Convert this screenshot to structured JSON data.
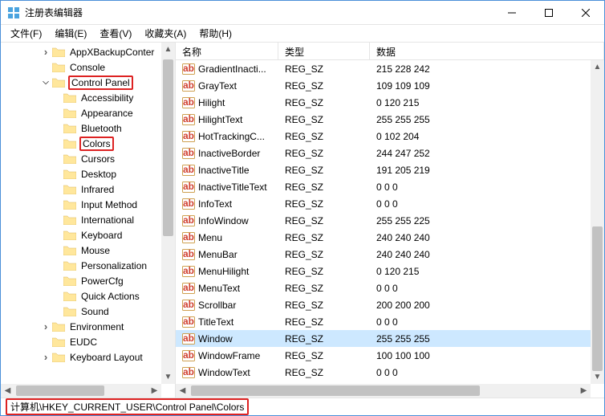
{
  "window": {
    "title": "注册表编辑器"
  },
  "menu": [
    "文件(F)",
    "编辑(E)",
    "查看(V)",
    "收藏夹(A)",
    "帮助(H)"
  ],
  "tree": [
    {
      "depth": 3,
      "twisty": "collapsed",
      "label": "AppXBackupConter",
      "hl": false
    },
    {
      "depth": 3,
      "twisty": "none",
      "label": "Console",
      "hl": false
    },
    {
      "depth": 3,
      "twisty": "expanded",
      "label": "Control Panel",
      "hl": true
    },
    {
      "depth": 4,
      "twisty": "none",
      "label": "Accessibility",
      "hl": false
    },
    {
      "depth": 4,
      "twisty": "none",
      "label": "Appearance",
      "hl": false
    },
    {
      "depth": 4,
      "twisty": "none",
      "label": "Bluetooth",
      "hl": false
    },
    {
      "depth": 4,
      "twisty": "none",
      "label": "Colors",
      "hl": true
    },
    {
      "depth": 4,
      "twisty": "none",
      "label": "Cursors",
      "hl": false
    },
    {
      "depth": 4,
      "twisty": "none",
      "label": "Desktop",
      "hl": false
    },
    {
      "depth": 4,
      "twisty": "none",
      "label": "Infrared",
      "hl": false
    },
    {
      "depth": 4,
      "twisty": "none",
      "label": "Input Method",
      "hl": false
    },
    {
      "depth": 4,
      "twisty": "none",
      "label": "International",
      "hl": false
    },
    {
      "depth": 4,
      "twisty": "none",
      "label": "Keyboard",
      "hl": false
    },
    {
      "depth": 4,
      "twisty": "none",
      "label": "Mouse",
      "hl": false
    },
    {
      "depth": 4,
      "twisty": "none",
      "label": "Personalization",
      "hl": false
    },
    {
      "depth": 4,
      "twisty": "none",
      "label": "PowerCfg",
      "hl": false
    },
    {
      "depth": 4,
      "twisty": "none",
      "label": "Quick Actions",
      "hl": false
    },
    {
      "depth": 4,
      "twisty": "none",
      "label": "Sound",
      "hl": false
    },
    {
      "depth": 3,
      "twisty": "collapsed",
      "label": "Environment",
      "hl": false
    },
    {
      "depth": 3,
      "twisty": "none",
      "label": "EUDC",
      "hl": false
    },
    {
      "depth": 3,
      "twisty": "collapsed",
      "label": "Keyboard Layout",
      "hl": false
    }
  ],
  "listHeader": {
    "name": "名称",
    "type": "类型",
    "data": "数据"
  },
  "values": [
    {
      "name": "GradientInacti...",
      "type": "REG_SZ",
      "data": "215 228 242",
      "sel": false
    },
    {
      "name": "GrayText",
      "type": "REG_SZ",
      "data": "109 109 109",
      "sel": false
    },
    {
      "name": "Hilight",
      "type": "REG_SZ",
      "data": "0 120 215",
      "sel": false
    },
    {
      "name": "HilightText",
      "type": "REG_SZ",
      "data": "255 255 255",
      "sel": false
    },
    {
      "name": "HotTrackingC...",
      "type": "REG_SZ",
      "data": "0 102 204",
      "sel": false
    },
    {
      "name": "InactiveBorder",
      "type": "REG_SZ",
      "data": "244 247 252",
      "sel": false
    },
    {
      "name": "InactiveTitle",
      "type": "REG_SZ",
      "data": "191 205 219",
      "sel": false
    },
    {
      "name": "InactiveTitleText",
      "type": "REG_SZ",
      "data": "0 0 0",
      "sel": false
    },
    {
      "name": "InfoText",
      "type": "REG_SZ",
      "data": "0 0 0",
      "sel": false
    },
    {
      "name": "InfoWindow",
      "type": "REG_SZ",
      "data": "255 255 225",
      "sel": false
    },
    {
      "name": "Menu",
      "type": "REG_SZ",
      "data": "240 240 240",
      "sel": false
    },
    {
      "name": "MenuBar",
      "type": "REG_SZ",
      "data": "240 240 240",
      "sel": false
    },
    {
      "name": "MenuHilight",
      "type": "REG_SZ",
      "data": "0 120 215",
      "sel": false
    },
    {
      "name": "MenuText",
      "type": "REG_SZ",
      "data": "0 0 0",
      "sel": false
    },
    {
      "name": "Scrollbar",
      "type": "REG_SZ",
      "data": "200 200 200",
      "sel": false
    },
    {
      "name": "TitleText",
      "type": "REG_SZ",
      "data": "0 0 0",
      "sel": false
    },
    {
      "name": "Window",
      "type": "REG_SZ",
      "data": "255 255 255",
      "sel": true
    },
    {
      "name": "WindowFrame",
      "type": "REG_SZ",
      "data": "100 100 100",
      "sel": false
    },
    {
      "name": "WindowText",
      "type": "REG_SZ",
      "data": "0 0 0",
      "sel": false
    }
  ],
  "status": {
    "path": "计算机\\HKEY_CURRENT_USER\\Control Panel\\Colors"
  }
}
